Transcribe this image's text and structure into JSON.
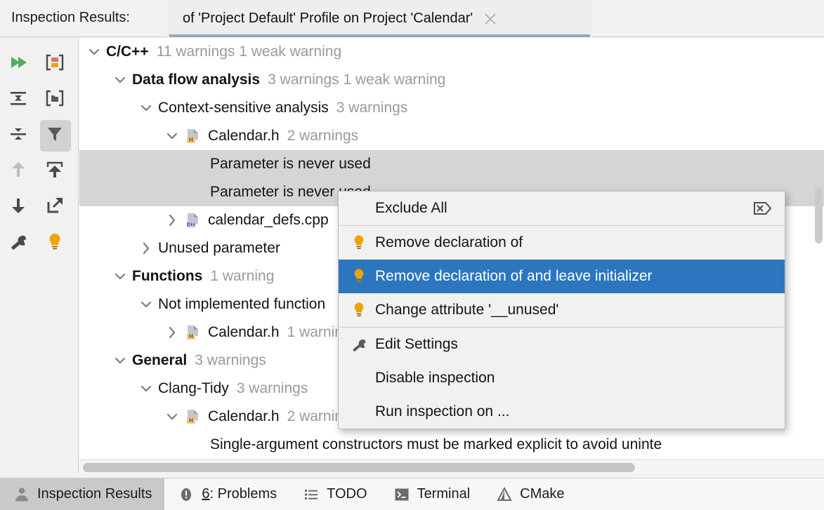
{
  "header": {
    "label": "Inspection Results:",
    "tab_title": "of 'Project Default' Profile on Project 'Calendar'",
    "close_icon": "close-icon"
  },
  "toolbar": {
    "items": [
      {
        "name": "rerun-inspection-icon",
        "title": "Rerun Inspection"
      },
      {
        "name": "severity-group-icon",
        "title": "Group by Severity"
      },
      {
        "name": "expand-all-icon",
        "title": "Expand All"
      },
      {
        "name": "group-by-directory-icon",
        "title": "Group by Directory"
      },
      {
        "name": "collapse-all-icon",
        "title": "Collapse All"
      },
      {
        "name": "filter-icon",
        "title": "Filter Inspections",
        "selected": true
      },
      {
        "name": "previous-problem-icon",
        "title": "Previous Problem",
        "disabled": true
      },
      {
        "name": "export-icon",
        "title": "Export"
      },
      {
        "name": "next-problem-icon",
        "title": "Next Problem"
      },
      {
        "name": "open-in-new-window-icon",
        "title": "Open in New Window"
      },
      {
        "name": "settings-wrench-icon",
        "title": "Edit Settings"
      },
      {
        "name": "quick-fix-bulb-icon",
        "title": "Quick Fix"
      }
    ]
  },
  "tree": {
    "rows": [
      {
        "indent": 0,
        "twisty": "down",
        "label": "C/C++",
        "bold": true,
        "count": "11 warnings 1 weak warning",
        "icon": null,
        "selected": false
      },
      {
        "indent": 1,
        "twisty": "down",
        "label": "Data flow analysis",
        "bold": true,
        "count": "3 warnings 1 weak warning",
        "icon": null,
        "selected": false
      },
      {
        "indent": 2,
        "twisty": "down",
        "label": "Context-sensitive analysis",
        "bold": false,
        "count": "3 warnings",
        "icon": null,
        "selected": false
      },
      {
        "indent": 3,
        "twisty": "down",
        "label": "Calendar.h",
        "bold": false,
        "count": "2 warnings",
        "icon": "h",
        "selected": false
      },
      {
        "indent": 4,
        "twisty": "none",
        "label": "Parameter is never used",
        "bold": false,
        "count": "",
        "icon": null,
        "selected": true
      },
      {
        "indent": 4,
        "twisty": "none",
        "label": "Parameter is never used",
        "bold": false,
        "count": "",
        "icon": null,
        "selected": true
      },
      {
        "indent": 3,
        "twisty": "right",
        "label": "calendar_defs.cpp",
        "bold": false,
        "count": "",
        "icon": "cpp",
        "selected": false
      },
      {
        "indent": 2,
        "twisty": "right",
        "label": "Unused parameter",
        "bold": false,
        "count": "",
        "icon": null,
        "selected": false
      },
      {
        "indent": 1,
        "twisty": "down",
        "label": "Functions",
        "bold": true,
        "count": "1 warning",
        "icon": null,
        "selected": false
      },
      {
        "indent": 2,
        "twisty": "down",
        "label": "Not implemented function",
        "bold": false,
        "count": "",
        "icon": null,
        "selected": false
      },
      {
        "indent": 3,
        "twisty": "right",
        "label": "Calendar.h",
        "bold": false,
        "count": "1 warning",
        "icon": "h",
        "selected": false
      },
      {
        "indent": 1,
        "twisty": "down",
        "label": "General",
        "bold": true,
        "count": "3 warnings",
        "icon": null,
        "selected": false
      },
      {
        "indent": 2,
        "twisty": "down",
        "label": "Clang-Tidy",
        "bold": false,
        "count": "3 warnings",
        "icon": null,
        "selected": false
      },
      {
        "indent": 3,
        "twisty": "down",
        "label": "Calendar.h",
        "bold": false,
        "count": "2 warnings",
        "icon": "h",
        "selected": false
      },
      {
        "indent": 4,
        "twisty": "none",
        "label": "Single-argument constructors must be marked explicit to avoid uninte",
        "bold": false,
        "count": "",
        "icon": null,
        "selected": false
      }
    ]
  },
  "context_menu": {
    "items": [
      {
        "label": "Exclude All",
        "icon": null,
        "right_icon": "exclude-all-icon",
        "highlight": false,
        "indent": true
      },
      {
        "label": "Remove declaration of",
        "icon": "bulb-icon",
        "right_icon": null,
        "highlight": false,
        "indent": false
      },
      {
        "label": "Remove declaration of and leave initializer",
        "icon": "bulb-icon",
        "right_icon": null,
        "highlight": true,
        "indent": false
      },
      {
        "label": "Change attribute '__unused'",
        "icon": "bulb-icon",
        "right_icon": null,
        "highlight": false,
        "indent": false
      },
      {
        "label": "Edit Settings",
        "icon": "wrench-icon",
        "right_icon": null,
        "highlight": false,
        "indent": false
      },
      {
        "label": "Disable inspection",
        "icon": null,
        "right_icon": null,
        "highlight": false,
        "indent": true
      },
      {
        "label": "Run inspection on ...",
        "icon": null,
        "right_icon": null,
        "highlight": false,
        "indent": true
      }
    ]
  },
  "bottom_bar": {
    "tabs": [
      {
        "label": "Inspection Results",
        "icon": "inspector-icon",
        "active": true,
        "mnemonic": ""
      },
      {
        "label": ": Problems",
        "icon": "problems-icon",
        "active": false,
        "mnemonic": "6"
      },
      {
        "label": "TODO",
        "icon": "todo-icon",
        "active": false,
        "mnemonic": ""
      },
      {
        "label": "Terminal",
        "icon": "terminal-icon",
        "active": false,
        "mnemonic": ""
      },
      {
        "label": "CMake",
        "icon": "cmake-icon",
        "active": false,
        "mnemonic": ""
      }
    ]
  },
  "colors": {
    "selection_blue": "#2b76bf",
    "row_selection_gray": "#d5d5d5",
    "bulb_orange": "#f0a202",
    "green_run": "#49a54d",
    "header_bg": "#f2f2f2",
    "tab_underline": "#9aa7ba"
  }
}
